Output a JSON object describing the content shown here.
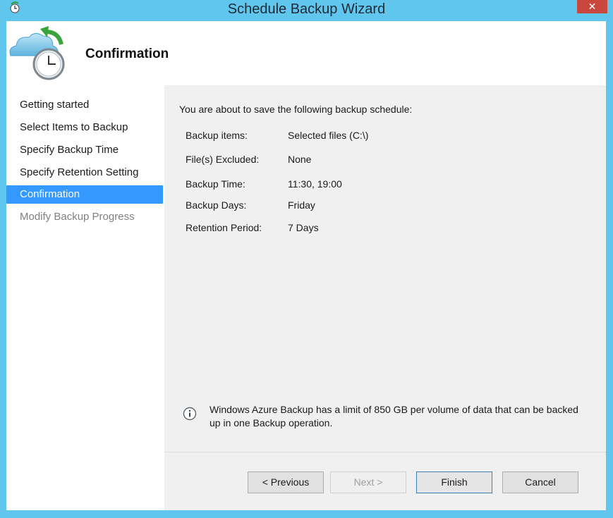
{
  "window": {
    "title": "Schedule Backup Wizard",
    "close_glyph": "✕"
  },
  "header": {
    "title": "Confirmation",
    "icon": "cloud-clock-icon"
  },
  "nav": {
    "items": [
      {
        "label": "Getting started",
        "state": "normal"
      },
      {
        "label": "Select Items to Backup",
        "state": "normal"
      },
      {
        "label": "Specify Backup Time",
        "state": "normal"
      },
      {
        "label": "Specify Retention Setting",
        "state": "normal"
      },
      {
        "label": "Confirmation",
        "state": "active"
      },
      {
        "label": "Modify Backup Progress",
        "state": "disabled"
      }
    ]
  },
  "content": {
    "intro": "You are about to save the following backup schedule:",
    "rows": [
      {
        "label": "Backup items:",
        "value": "Selected files (C:\\)"
      },
      {
        "label": "File(s) Excluded:",
        "value": "None"
      },
      {
        "label": "Backup Time:",
        "value": "11:30, 19:00"
      },
      {
        "label": "Backup Days:",
        "value": "Friday"
      },
      {
        "label": "Retention Period:",
        "value": "7 Days"
      }
    ],
    "info": "Windows Azure Backup has a limit of 850 GB per volume of data that can be backed up in one Backup operation."
  },
  "buttons": {
    "previous": "< Previous",
    "next": "Next >",
    "finish": "Finish",
    "cancel": "Cancel"
  },
  "colors": {
    "accent": "#3399ff",
    "title_bar": "#61c6ee",
    "close": "#c9483d"
  }
}
